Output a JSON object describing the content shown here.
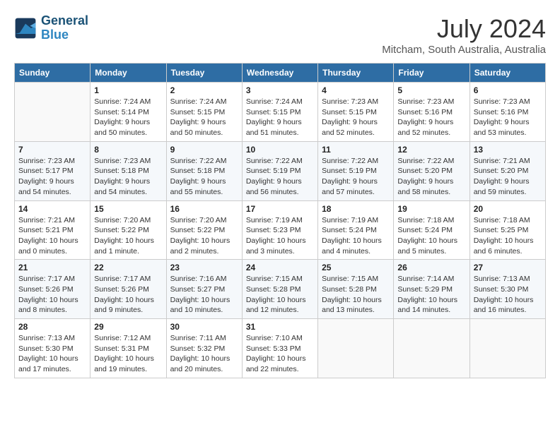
{
  "logo": {
    "line1": "General",
    "line2": "Blue"
  },
  "title": "July 2024",
  "location": "Mitcham, South Australia, Australia",
  "days_header": [
    "Sunday",
    "Monday",
    "Tuesday",
    "Wednesday",
    "Thursday",
    "Friday",
    "Saturday"
  ],
  "weeks": [
    [
      {
        "day": "",
        "sunrise": "",
        "sunset": "",
        "daylight": ""
      },
      {
        "day": "1",
        "sunrise": "Sunrise: 7:24 AM",
        "sunset": "Sunset: 5:14 PM",
        "daylight": "Daylight: 9 hours and 50 minutes."
      },
      {
        "day": "2",
        "sunrise": "Sunrise: 7:24 AM",
        "sunset": "Sunset: 5:15 PM",
        "daylight": "Daylight: 9 hours and 50 minutes."
      },
      {
        "day": "3",
        "sunrise": "Sunrise: 7:24 AM",
        "sunset": "Sunset: 5:15 PM",
        "daylight": "Daylight: 9 hours and 51 minutes."
      },
      {
        "day": "4",
        "sunrise": "Sunrise: 7:23 AM",
        "sunset": "Sunset: 5:15 PM",
        "daylight": "Daylight: 9 hours and 52 minutes."
      },
      {
        "day": "5",
        "sunrise": "Sunrise: 7:23 AM",
        "sunset": "Sunset: 5:16 PM",
        "daylight": "Daylight: 9 hours and 52 minutes."
      },
      {
        "day": "6",
        "sunrise": "Sunrise: 7:23 AM",
        "sunset": "Sunset: 5:16 PM",
        "daylight": "Daylight: 9 hours and 53 minutes."
      }
    ],
    [
      {
        "day": "7",
        "sunrise": "Sunrise: 7:23 AM",
        "sunset": "Sunset: 5:17 PM",
        "daylight": "Daylight: 9 hours and 54 minutes."
      },
      {
        "day": "8",
        "sunrise": "Sunrise: 7:23 AM",
        "sunset": "Sunset: 5:18 PM",
        "daylight": "Daylight: 9 hours and 54 minutes."
      },
      {
        "day": "9",
        "sunrise": "Sunrise: 7:22 AM",
        "sunset": "Sunset: 5:18 PM",
        "daylight": "Daylight: 9 hours and 55 minutes."
      },
      {
        "day": "10",
        "sunrise": "Sunrise: 7:22 AM",
        "sunset": "Sunset: 5:19 PM",
        "daylight": "Daylight: 9 hours and 56 minutes."
      },
      {
        "day": "11",
        "sunrise": "Sunrise: 7:22 AM",
        "sunset": "Sunset: 5:19 PM",
        "daylight": "Daylight: 9 hours and 57 minutes."
      },
      {
        "day": "12",
        "sunrise": "Sunrise: 7:22 AM",
        "sunset": "Sunset: 5:20 PM",
        "daylight": "Daylight: 9 hours and 58 minutes."
      },
      {
        "day": "13",
        "sunrise": "Sunrise: 7:21 AM",
        "sunset": "Sunset: 5:20 PM",
        "daylight": "Daylight: 9 hours and 59 minutes."
      }
    ],
    [
      {
        "day": "14",
        "sunrise": "Sunrise: 7:21 AM",
        "sunset": "Sunset: 5:21 PM",
        "daylight": "Daylight: 10 hours and 0 minutes."
      },
      {
        "day": "15",
        "sunrise": "Sunrise: 7:20 AM",
        "sunset": "Sunset: 5:22 PM",
        "daylight": "Daylight: 10 hours and 1 minute."
      },
      {
        "day": "16",
        "sunrise": "Sunrise: 7:20 AM",
        "sunset": "Sunset: 5:22 PM",
        "daylight": "Daylight: 10 hours and 2 minutes."
      },
      {
        "day": "17",
        "sunrise": "Sunrise: 7:19 AM",
        "sunset": "Sunset: 5:23 PM",
        "daylight": "Daylight: 10 hours and 3 minutes."
      },
      {
        "day": "18",
        "sunrise": "Sunrise: 7:19 AM",
        "sunset": "Sunset: 5:24 PM",
        "daylight": "Daylight: 10 hours and 4 minutes."
      },
      {
        "day": "19",
        "sunrise": "Sunrise: 7:18 AM",
        "sunset": "Sunset: 5:24 PM",
        "daylight": "Daylight: 10 hours and 5 minutes."
      },
      {
        "day": "20",
        "sunrise": "Sunrise: 7:18 AM",
        "sunset": "Sunset: 5:25 PM",
        "daylight": "Daylight: 10 hours and 6 minutes."
      }
    ],
    [
      {
        "day": "21",
        "sunrise": "Sunrise: 7:17 AM",
        "sunset": "Sunset: 5:26 PM",
        "daylight": "Daylight: 10 hours and 8 minutes."
      },
      {
        "day": "22",
        "sunrise": "Sunrise: 7:17 AM",
        "sunset": "Sunset: 5:26 PM",
        "daylight": "Daylight: 10 hours and 9 minutes."
      },
      {
        "day": "23",
        "sunrise": "Sunrise: 7:16 AM",
        "sunset": "Sunset: 5:27 PM",
        "daylight": "Daylight: 10 hours and 10 minutes."
      },
      {
        "day": "24",
        "sunrise": "Sunrise: 7:15 AM",
        "sunset": "Sunset: 5:28 PM",
        "daylight": "Daylight: 10 hours and 12 minutes."
      },
      {
        "day": "25",
        "sunrise": "Sunrise: 7:15 AM",
        "sunset": "Sunset: 5:28 PM",
        "daylight": "Daylight: 10 hours and 13 minutes."
      },
      {
        "day": "26",
        "sunrise": "Sunrise: 7:14 AM",
        "sunset": "Sunset: 5:29 PM",
        "daylight": "Daylight: 10 hours and 14 minutes."
      },
      {
        "day": "27",
        "sunrise": "Sunrise: 7:13 AM",
        "sunset": "Sunset: 5:30 PM",
        "daylight": "Daylight: 10 hours and 16 minutes."
      }
    ],
    [
      {
        "day": "28",
        "sunrise": "Sunrise: 7:13 AM",
        "sunset": "Sunset: 5:30 PM",
        "daylight": "Daylight: 10 hours and 17 minutes."
      },
      {
        "day": "29",
        "sunrise": "Sunrise: 7:12 AM",
        "sunset": "Sunset: 5:31 PM",
        "daylight": "Daylight: 10 hours and 19 minutes."
      },
      {
        "day": "30",
        "sunrise": "Sunrise: 7:11 AM",
        "sunset": "Sunset: 5:32 PM",
        "daylight": "Daylight: 10 hours and 20 minutes."
      },
      {
        "day": "31",
        "sunrise": "Sunrise: 7:10 AM",
        "sunset": "Sunset: 5:33 PM",
        "daylight": "Daylight: 10 hours and 22 minutes."
      },
      {
        "day": "",
        "sunrise": "",
        "sunset": "",
        "daylight": ""
      },
      {
        "day": "",
        "sunrise": "",
        "sunset": "",
        "daylight": ""
      },
      {
        "day": "",
        "sunrise": "",
        "sunset": "",
        "daylight": ""
      }
    ]
  ]
}
